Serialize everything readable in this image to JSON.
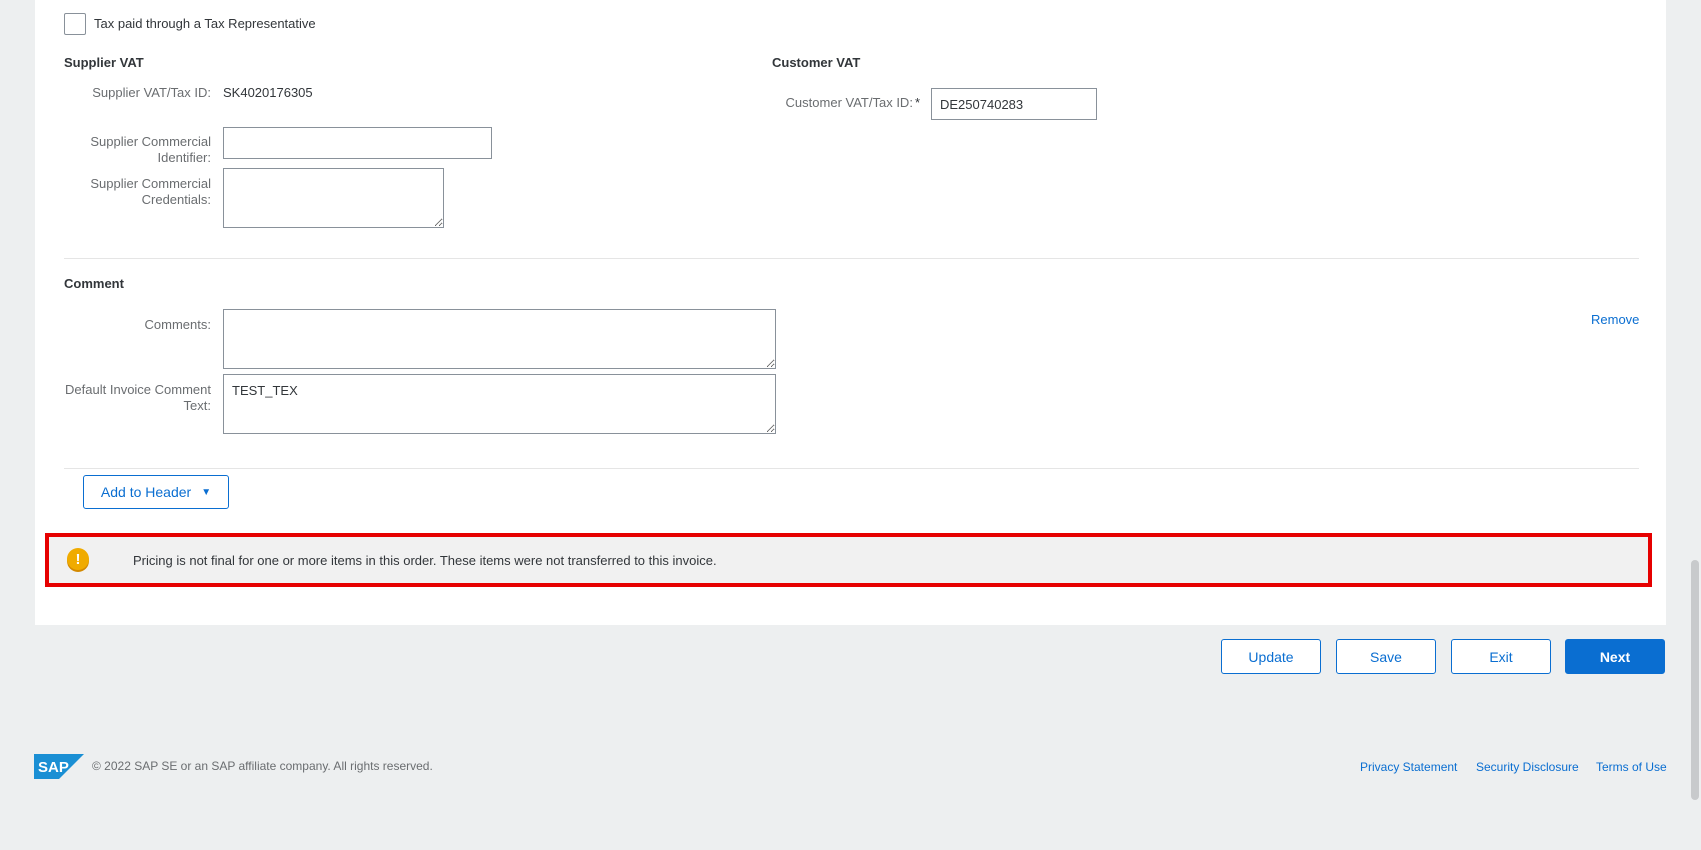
{
  "tax_rep": {
    "checkbox_label": "Tax paid through a Tax Representative"
  },
  "supplier_vat": {
    "title": "Supplier VAT",
    "tax_id_label": "Supplier VAT/Tax ID:",
    "tax_id_value": "SK4020176305",
    "commercial_identifier_label_line1": "Supplier Commercial",
    "commercial_identifier_label_line2": "Identifier:",
    "commercial_identifier_value": "",
    "commercial_credentials_label_line1": "Supplier Commercial",
    "commercial_credentials_label_line2": "Credentials:",
    "commercial_credentials_value": ""
  },
  "customer_vat": {
    "title": "Customer VAT",
    "tax_id_label": "Customer VAT/Tax ID:",
    "required_marker": "*",
    "tax_id_value": "DE250740283"
  },
  "comment": {
    "title": "Comment",
    "comments_label": "Comments:",
    "comments_value": "",
    "remove_link": "Remove",
    "default_text_label_line1": "Default Invoice Comment",
    "default_text_label_line2": "Text:",
    "default_text_value": "TEST_TEX"
  },
  "add_to_header": {
    "label": "Add to Header",
    "caret": "▼"
  },
  "message": {
    "icon": "warning-icon",
    "icon_glyph": "!",
    "text": "Pricing is not final for one or more items in this order. These items were not transferred to this invoice."
  },
  "actions": {
    "update": "Update",
    "save": "Save",
    "exit": "Exit",
    "next": "Next"
  },
  "footer": {
    "logo_text": "SAP",
    "copyright": "© 2022 SAP SE or an SAP affiliate company. All rights reserved.",
    "privacy": "Privacy Statement",
    "security": "Security Disclosure",
    "terms": "Terms of Use"
  },
  "colors": {
    "accent": "#0a6ed1",
    "highlight_border": "#e60000",
    "warning": "#f0ab00",
    "page_bg": "#edeff0"
  }
}
